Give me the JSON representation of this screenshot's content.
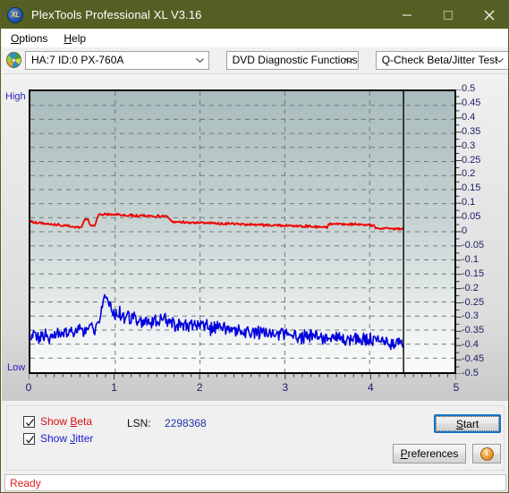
{
  "window": {
    "title": "PlexTools Professional XL V3.16",
    "app_icon": "XL",
    "minimize_icon": "minimize-icon",
    "maximize_icon": "maximize-icon",
    "close_icon": "close-icon",
    "titlebar_color": "#555f24"
  },
  "menu": {
    "items": [
      {
        "label": "Options",
        "accel": "O"
      },
      {
        "label": "Help",
        "accel": "H"
      }
    ]
  },
  "toolbar": {
    "disc_icon": "disc-icon",
    "drive_select": {
      "value": "HA:7 ID:0  PX-760A",
      "options": [
        "HA:7 ID:0  PX-760A"
      ]
    },
    "function_select": {
      "value": "DVD Diagnostic Functions",
      "options": [
        "DVD Diagnostic Functions"
      ]
    },
    "test_select": {
      "value": "Q-Check Beta/Jitter Test",
      "options": [
        "Q-Check Beta/Jitter Test"
      ]
    }
  },
  "chart_data": {
    "type": "line",
    "title": "Q-Check Beta/Jitter Test",
    "xlabel": "",
    "ylabel": "",
    "xlim": [
      0,
      5
    ],
    "ylim": [
      -0.5,
      0.5
    ],
    "grid": true,
    "legend_position": "bottom-left",
    "x_ticks": [
      "0",
      "1",
      "2",
      "3",
      "4",
      "5"
    ],
    "y_ticks": [
      "0.5",
      "0.45",
      "0.4",
      "0.35",
      "0.3",
      "0.25",
      "0.2",
      "0.15",
      "0.1",
      "0.05",
      "0",
      "-0.05",
      "-0.1",
      "-0.15",
      "-0.2",
      "-0.25",
      "-0.3",
      "-0.35",
      "-0.4",
      "-0.45",
      "-0.5"
    ],
    "axis_top_label": "High",
    "axis_bottom_label": "Low",
    "data_end_x": 4.4,
    "marker_line_x": 4.4,
    "series": [
      {
        "name": "Beta",
        "color": "#ee0000",
        "x": [
          0.0,
          0.12,
          0.24,
          0.36,
          0.45,
          0.47,
          0.5,
          0.55,
          0.6,
          0.63,
          0.66,
          0.68,
          0.7,
          0.73,
          0.76,
          0.8,
          0.9,
          1.0,
          1.1,
          1.2,
          1.3,
          1.4,
          1.5,
          1.6,
          1.62,
          1.66,
          1.7,
          1.8,
          1.9,
          2.0,
          2.1,
          2.2,
          2.4,
          2.6,
          2.8,
          3.0,
          3.2,
          3.4,
          3.5,
          3.52,
          3.56,
          3.7,
          3.9,
          4.0,
          4.05,
          4.08,
          4.12,
          4.2,
          4.3,
          4.4
        ],
        "y": [
          0.035,
          0.031,
          0.027,
          0.023,
          0.02,
          0.019,
          0.018,
          0.016,
          0.014,
          0.04,
          0.046,
          0.047,
          0.022,
          0.02,
          0.019,
          0.06,
          0.062,
          0.061,
          0.059,
          0.058,
          0.057,
          0.056,
          0.055,
          0.054,
          0.053,
          0.036,
          0.035,
          0.034,
          0.033,
          0.032,
          0.031,
          0.03,
          0.028,
          0.026,
          0.024,
          0.022,
          0.02,
          0.018,
          0.017,
          0.028,
          0.029,
          0.027,
          0.025,
          0.024,
          0.023,
          0.012,
          0.011,
          0.012,
          0.011,
          0.01
        ]
      },
      {
        "name": "Jitter",
        "color": "#0000dd",
        "x": [
          0.0,
          0.1,
          0.2,
          0.3,
          0.4,
          0.5,
          0.6,
          0.7,
          0.78,
          0.84,
          0.87,
          0.9,
          0.95,
          1.0,
          1.1,
          1.2,
          1.3,
          1.4,
          1.5,
          1.56,
          1.6,
          1.7,
          1.8,
          1.9,
          2.0,
          2.1,
          2.2,
          2.3,
          2.4,
          2.5,
          2.6,
          2.7,
          2.8,
          2.9,
          3.0,
          3.2,
          3.4,
          3.6,
          3.8,
          4.0,
          4.2,
          4.3,
          4.38,
          4.4
        ],
        "y": [
          -0.37,
          -0.372,
          -0.373,
          -0.368,
          -0.365,
          -0.358,
          -0.35,
          -0.345,
          -0.34,
          -0.28,
          -0.225,
          -0.25,
          -0.275,
          -0.29,
          -0.3,
          -0.31,
          -0.318,
          -0.322,
          -0.325,
          -0.3,
          -0.318,
          -0.326,
          -0.33,
          -0.334,
          -0.338,
          -0.342,
          -0.345,
          -0.348,
          -0.352,
          -0.355,
          -0.358,
          -0.36,
          -0.362,
          -0.364,
          -0.366,
          -0.37,
          -0.374,
          -0.378,
          -0.382,
          -0.386,
          -0.39,
          -0.394,
          -0.398,
          -0.4
        ]
      }
    ]
  },
  "controls": {
    "show_beta": {
      "label": "Show ",
      "accel": "B",
      "label_rest": "eta",
      "checked": true,
      "color": "#d31111"
    },
    "show_jitter": {
      "label": "Show ",
      "accel": "J",
      "label_rest": "itter",
      "checked": true,
      "color": "#1b1bcd"
    },
    "lsn_label": "LSN:",
    "lsn_value": "2298368",
    "start_button": {
      "label": "Start",
      "accel": "S",
      "rest": "tart"
    },
    "preferences_button": {
      "label": "Preferences",
      "accel": "P",
      "rest": "references"
    },
    "info_button": {
      "icon": "info-icon",
      "glyph": "i"
    }
  },
  "status": {
    "text": "Ready",
    "color": "#e02020"
  }
}
